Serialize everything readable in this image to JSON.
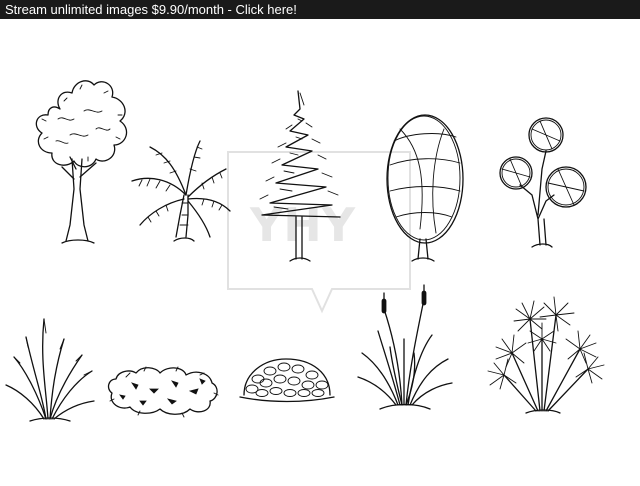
{
  "banner": {
    "text": "Stream unlimited images $9.90/month - Click here!",
    "background": "#1a1a1a",
    "color": "#ffffff"
  },
  "watermark": {
    "logo_text": "YHY"
  },
  "illustration": {
    "style": "black ink line sketches on white",
    "objects": [
      "deciduous-tree",
      "palm-tree",
      "conifer-tree",
      "oval-tree",
      "round-leaf-sapling",
      "grass-clump",
      "low-shrub",
      "ground-cover",
      "cattail-grass",
      "papyrus-plant"
    ]
  }
}
